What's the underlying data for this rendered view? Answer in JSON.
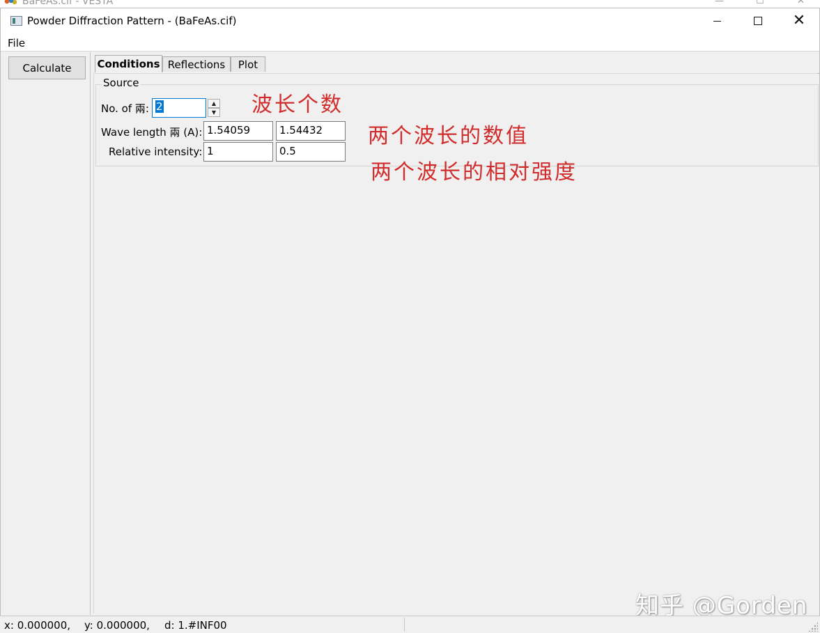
{
  "background_window": {
    "title": "BaFeAs.cif - VESTA"
  },
  "window": {
    "title": "Powder Diffraction Pattern - (BaFeAs.cif)"
  },
  "menu": {
    "file": "File"
  },
  "toolbar": {
    "calculate": "Calculate"
  },
  "tabs": [
    {
      "label": "Conditions",
      "active": true
    },
    {
      "label": "Reflections",
      "active": false
    },
    {
      "label": "Plot",
      "active": false
    }
  ],
  "source": {
    "group_title": "Source",
    "num_wavelengths_label": "No. of 兩:",
    "num_wavelengths_value": "2",
    "wavelength_label": "Wave length 兩 (A):",
    "wavelength_values": [
      "1.54059",
      "1.54432"
    ],
    "intensity_label": "Relative intensity:",
    "intensity_values": [
      "1",
      "0.5"
    ]
  },
  "annotations": {
    "num_wavelengths": "波长个数",
    "wavelength_values": "两个波长的数值",
    "relative_intensity": "两个波长的相对强度",
    "color": "#d12b2b"
  },
  "watermark": "知乎 @Gorden",
  "status": {
    "x": "x: 0.000000,",
    "y": "y: 0.000000,",
    "d": "d: 1.#INF00"
  },
  "colors": {
    "focus_border": "#0078d7",
    "panel_bg": "#f0f0f0"
  }
}
